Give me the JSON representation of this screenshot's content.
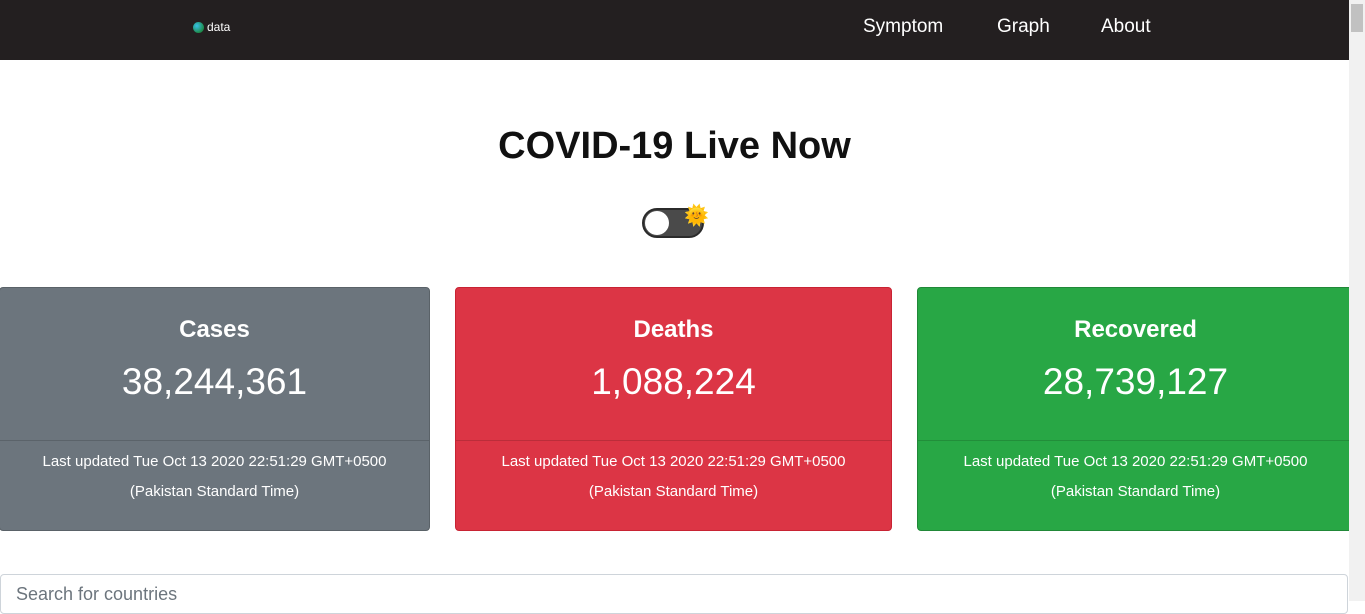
{
  "nav": {
    "brand": "data",
    "links": [
      "Symptom",
      "Graph",
      "About"
    ]
  },
  "hero": {
    "title": "COVID-19 Live Now"
  },
  "icons": {
    "theme_toggle_icon": "sun-icon"
  },
  "cards": [
    {
      "title": "Cases",
      "value": "38,244,361",
      "updated_line1": "Last updated Tue Oct 13 2020 22:51:29 GMT+0500",
      "updated_line2": "(Pakistan Standard Time)",
      "color": "#6c757d"
    },
    {
      "title": "Deaths",
      "value": "1,088,224",
      "updated_line1": "Last updated Tue Oct 13 2020 22:51:29 GMT+0500",
      "updated_line2": "(Pakistan Standard Time)",
      "color": "#dc3545"
    },
    {
      "title": "Recovered",
      "value": "28,739,127",
      "updated_line1": "Last updated Tue Oct 13 2020 22:51:29 GMT+0500",
      "updated_line2": "(Pakistan Standard Time)",
      "color": "#28a745"
    }
  ],
  "search": {
    "placeholder": "Search for countries"
  }
}
